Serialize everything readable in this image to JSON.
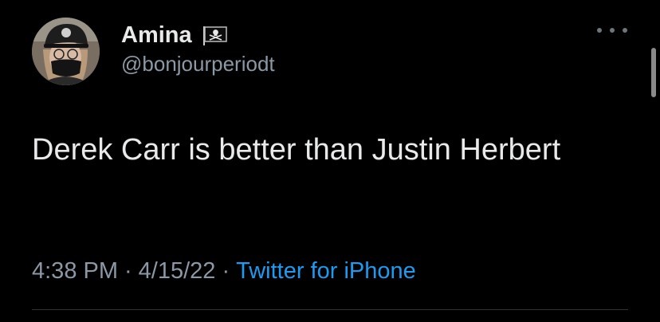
{
  "tweet": {
    "author": {
      "display_name": "Amina",
      "handle": "@bonjourperiodt",
      "name_emoji": "pirate-flag-icon"
    },
    "text": "Derek Carr is better than Justin Herbert",
    "time": "4:38 PM",
    "date": "4/15/22",
    "separator": "·",
    "source": "Twitter for iPhone"
  },
  "icons": {
    "more": "more-horizontal-icon",
    "avatar": "avatar"
  },
  "colors": {
    "background": "#000000",
    "primary_text": "#e7e9ea",
    "secondary_text": "#8b98a5",
    "link": "#1d9bf0",
    "divider": "#2f3336"
  }
}
